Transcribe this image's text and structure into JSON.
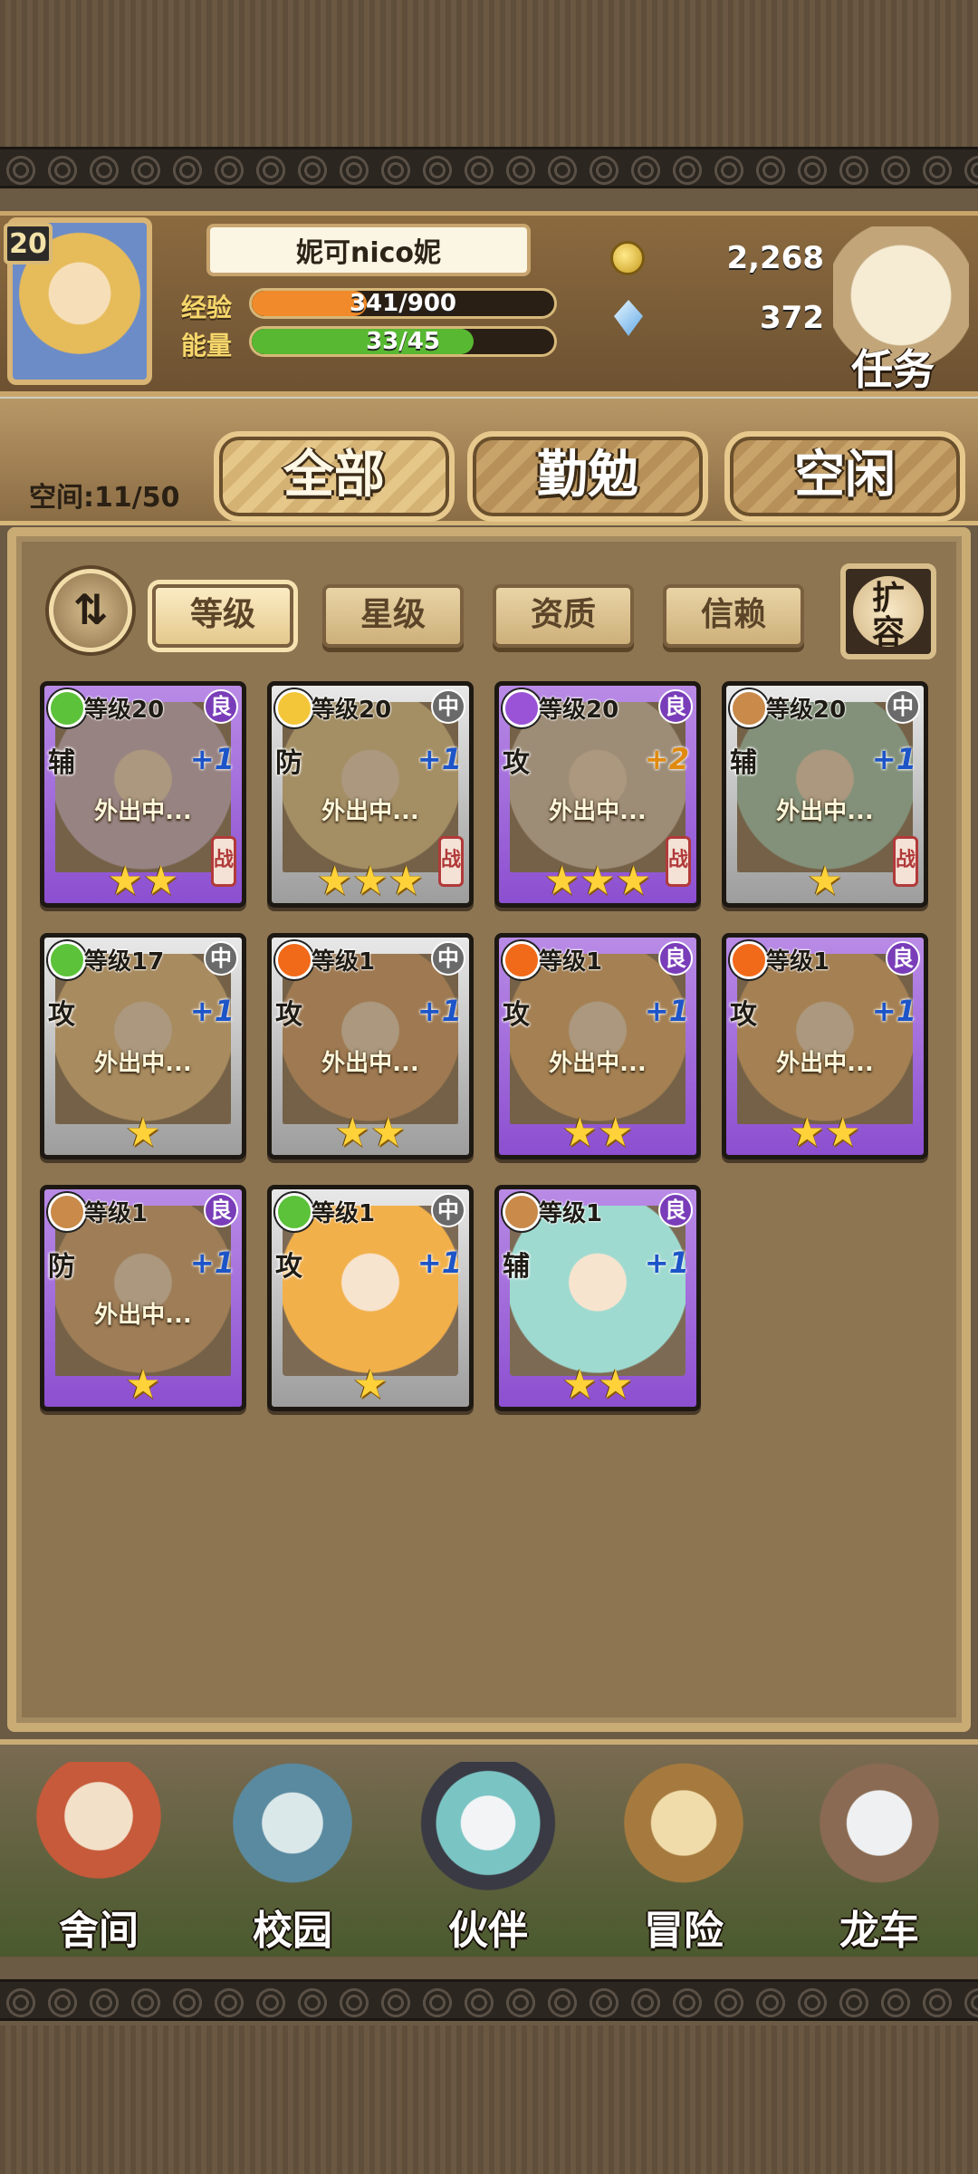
{
  "player": {
    "level": "20",
    "name": "妮可nico妮",
    "exp_label": "经验",
    "exp_text": "341/900",
    "exp_fraction": 0.379,
    "energy_label": "能量",
    "energy_text": "33/45",
    "energy_fraction": 0.733
  },
  "currency": {
    "coins": "2,268",
    "gems": "372"
  },
  "quest_label": "任务",
  "space_label": "空间:11/50",
  "main_tabs": [
    "全部",
    "勤勉",
    "空闲"
  ],
  "filters": [
    "等级",
    "星级",
    "资质",
    "信赖"
  ],
  "sort_icon": "⇅",
  "expand_label_top": "扩",
  "expand_label_bottom": "容",
  "cards": [
    {
      "element": "grass",
      "level": "等级20",
      "quality": "良",
      "role": "辅",
      "bonus": "+1",
      "status": "外出中...",
      "battle": "战",
      "stars": "★★",
      "frame": "good"
    },
    {
      "element": "light",
      "level": "等级20",
      "quality": "中",
      "role": "防",
      "bonus": "+1",
      "status": "外出中...",
      "battle": "战",
      "stars": "★★★",
      "frame": "mid"
    },
    {
      "element": "arcane",
      "level": "等级20",
      "quality": "良",
      "role": "攻",
      "bonus": "+2",
      "status": "外出中...",
      "battle": "战",
      "stars": "★★★",
      "frame": "good"
    },
    {
      "element": "earth",
      "level": "等级20",
      "quality": "中",
      "role": "辅",
      "bonus": "+1",
      "status": "外出中...",
      "battle": "战",
      "stars": "★",
      "frame": "mid"
    },
    {
      "element": "grass",
      "level": "等级17",
      "quality": "中",
      "role": "攻",
      "bonus": "+1",
      "status": "外出中...",
      "battle": "",
      "stars": "★",
      "frame": "mid"
    },
    {
      "element": "fire",
      "level": "等级1",
      "quality": "中",
      "role": "攻",
      "bonus": "+1",
      "status": "外出中...",
      "battle": "",
      "stars": "★★",
      "frame": "mid"
    },
    {
      "element": "fire",
      "level": "等级1",
      "quality": "良",
      "role": "攻",
      "bonus": "+1",
      "status": "外出中...",
      "battle": "",
      "stars": "★★",
      "frame": "good"
    },
    {
      "element": "fire",
      "level": "等级1",
      "quality": "良",
      "role": "攻",
      "bonus": "+1",
      "status": "外出中...",
      "battle": "",
      "stars": "★★",
      "frame": "good"
    },
    {
      "element": "earth",
      "level": "等级1",
      "quality": "良",
      "role": "防",
      "bonus": "+1",
      "status": "外出中...",
      "battle": "",
      "stars": "★",
      "frame": "good"
    },
    {
      "element": "grass",
      "level": "等级1",
      "quality": "中",
      "role": "攻",
      "bonus": "+1",
      "status": "",
      "battle": "",
      "stars": "★",
      "frame": "mid"
    },
    {
      "element": "earth",
      "level": "等级1",
      "quality": "良",
      "role": "辅",
      "bonus": "+1",
      "status": "",
      "battle": "",
      "stars": "★★",
      "frame": "good"
    }
  ],
  "nav": [
    "舍间",
    "校园",
    "伙伴",
    "冒险",
    "龙车"
  ],
  "colors": {
    "exp_bar": "#f08a2a",
    "energy_bar": "#58b832",
    "grass": "#5cc23a",
    "light": "#f3c63a",
    "arcane": "#9a52d6",
    "earth": "#c98a4a",
    "fire": "#f06a1a"
  }
}
